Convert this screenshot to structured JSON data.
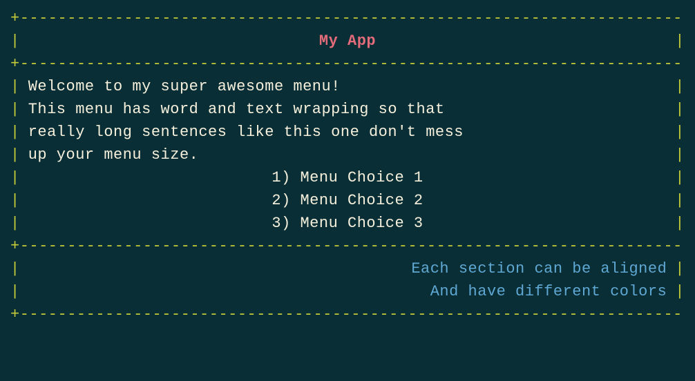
{
  "border": {
    "top": "+------------------------------------------------------------------------+",
    "mid": "+------------------------------------------------------------------------+",
    "bottom": "+------------------------------------------------------------------------+"
  },
  "title": "My App",
  "body": {
    "line1": "Welcome to my super awesome menu!",
    "line2": "This menu has word and text wrapping so that",
    "line3": "really long sentences like this one don't mess",
    "line4": "up your menu size."
  },
  "menu": {
    "item1": "1) Menu Choice 1",
    "item2": "2) Menu Choice 2",
    "item3": "3) Menu Choice 3"
  },
  "footer": {
    "line1": "Each section can be aligned",
    "line2": "And have different colors"
  }
}
